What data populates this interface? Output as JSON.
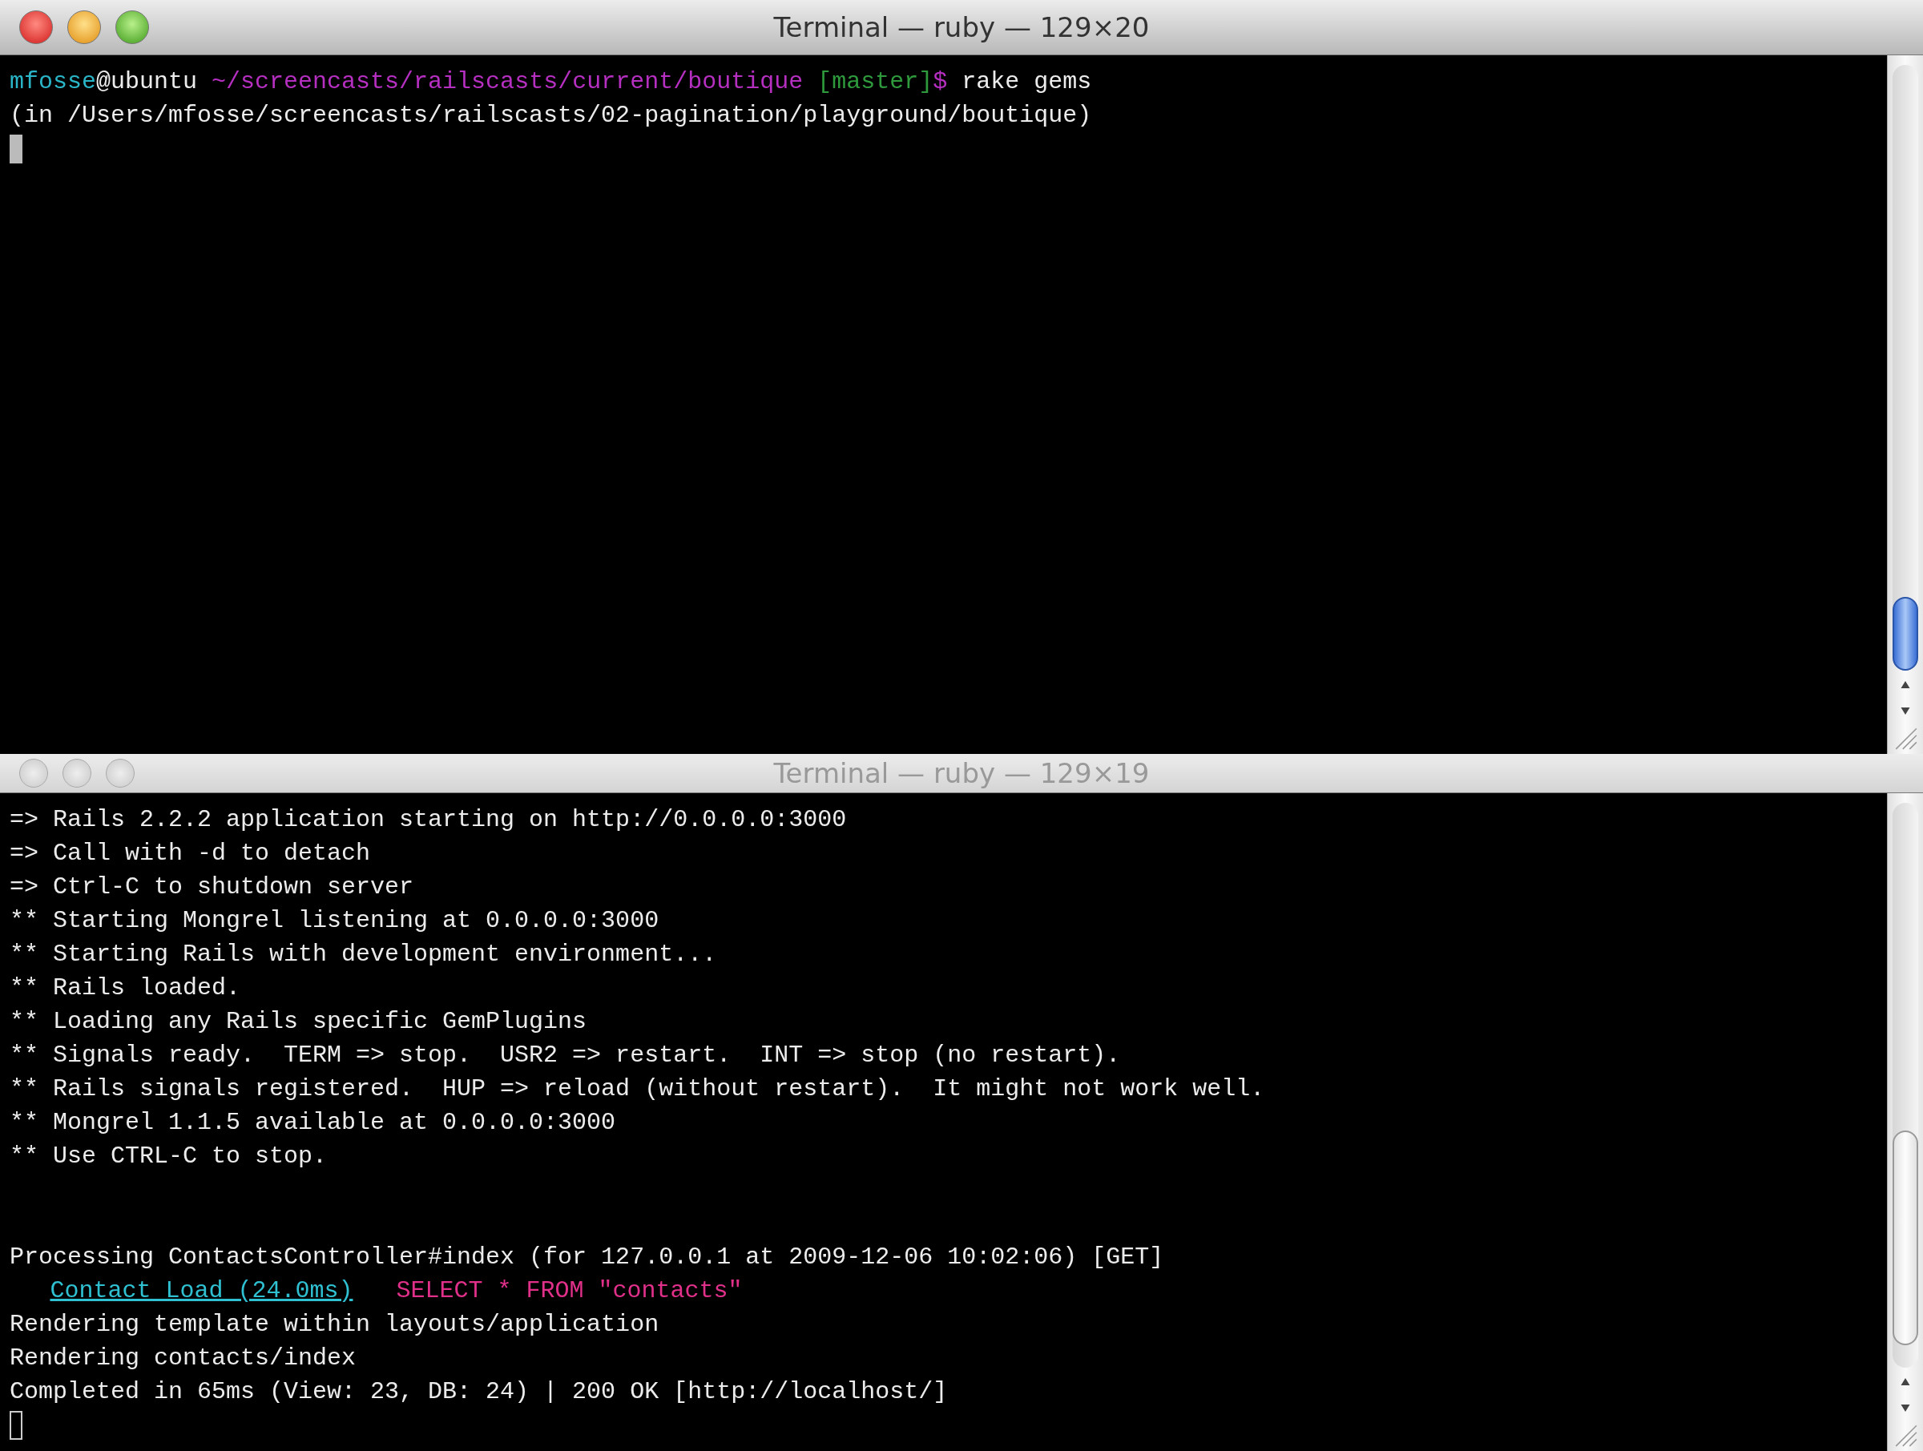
{
  "windows": [
    {
      "title": "Terminal — ruby — 129×20",
      "active": true,
      "blocks": [
        {
          "lines": [
            {
              "segments": [
                {
                  "text": "mfosse",
                  "color": "#2bb5c8"
                },
                {
                  "text": "@ubuntu",
                  "color": "#ececec"
                },
                {
                  "text": " ~/screencasts/railscasts/current/boutique",
                  "color": "#b52fc0"
                },
                {
                  "text": " [master]",
                  "color": "#2e9a3c"
                },
                {
                  "text": "$",
                  "color": "#b52fc0"
                },
                {
                  "text": " rake gems",
                  "color": "#ececec"
                }
              ]
            },
            {
              "segments": [
                {
                  "text": "(in /Users/mfosse/screencasts/railscasts/02-pagination/playground/boutique)",
                  "color": "#ececec"
                }
              ]
            }
          ]
        }
      ]
    },
    {
      "title": "Terminal — ruby — 129×19",
      "active": false,
      "blocks": [
        {
          "lines": [
            {
              "segments": [
                {
                  "text": "=> Rails 2.2.2 application starting on http://0.0.0.0:3000",
                  "color": "#ececec"
                }
              ]
            },
            {
              "segments": [
                {
                  "text": "=> Call with -d to detach",
                  "color": "#ececec"
                }
              ]
            },
            {
              "segments": [
                {
                  "text": "=> Ctrl-C to shutdown server",
                  "color": "#ececec"
                }
              ]
            },
            {
              "segments": [
                {
                  "text": "** Starting Mongrel listening at 0.0.0.0:3000",
                  "color": "#ececec"
                }
              ]
            },
            {
              "segments": [
                {
                  "text": "** Starting Rails with development environment...",
                  "color": "#ececec"
                }
              ]
            },
            {
              "segments": [
                {
                  "text": "** Rails loaded.",
                  "color": "#ececec"
                }
              ]
            },
            {
              "segments": [
                {
                  "text": "** Loading any Rails specific GemPlugins",
                  "color": "#ececec"
                }
              ]
            },
            {
              "segments": [
                {
                  "text": "** Signals ready.  TERM => stop.  USR2 => restart.  INT => stop (no restart).",
                  "color": "#ececec"
                }
              ]
            },
            {
              "segments": [
                {
                  "text": "** Rails signals registered.  HUP => reload (without restart).  It might not work well.",
                  "color": "#ececec"
                }
              ]
            },
            {
              "segments": [
                {
                  "text": "** Mongrel 1.1.5 available at 0.0.0.0:3000",
                  "color": "#ececec"
                }
              ]
            },
            {
              "segments": [
                {
                  "text": "** Use CTRL-C to stop.",
                  "color": "#ececec"
                }
              ]
            }
          ]
        },
        {
          "lines": [
            {
              "segments": [
                {
                  "text": "Processing ContactsController#index (for 127.0.0.1 at 2009-12-06 10:02:06) [GET]",
                  "color": "#ececec"
                }
              ]
            },
            {
              "indent": true,
              "segments": [
                {
                  "text": "Contact Load (24.0ms)",
                  "color": "#2fc0d2",
                  "underline": true
                },
                {
                  "text": "SELECT * FROM \"contacts\"",
                  "color": "#e0308a",
                  "gap": true
                }
              ]
            },
            {
              "segments": [
                {
                  "text": "Rendering template within layouts/application",
                  "color": "#ececec"
                }
              ]
            },
            {
              "segments": [
                {
                  "text": "Rendering contacts/index",
                  "color": "#ececec"
                }
              ]
            },
            {
              "segments": [
                {
                  "text": "Completed in 65ms (View: 23, DB: 24) | 200 OK [http://localhost/]",
                  "color": "#ececec"
                }
              ]
            }
          ]
        }
      ]
    }
  ]
}
